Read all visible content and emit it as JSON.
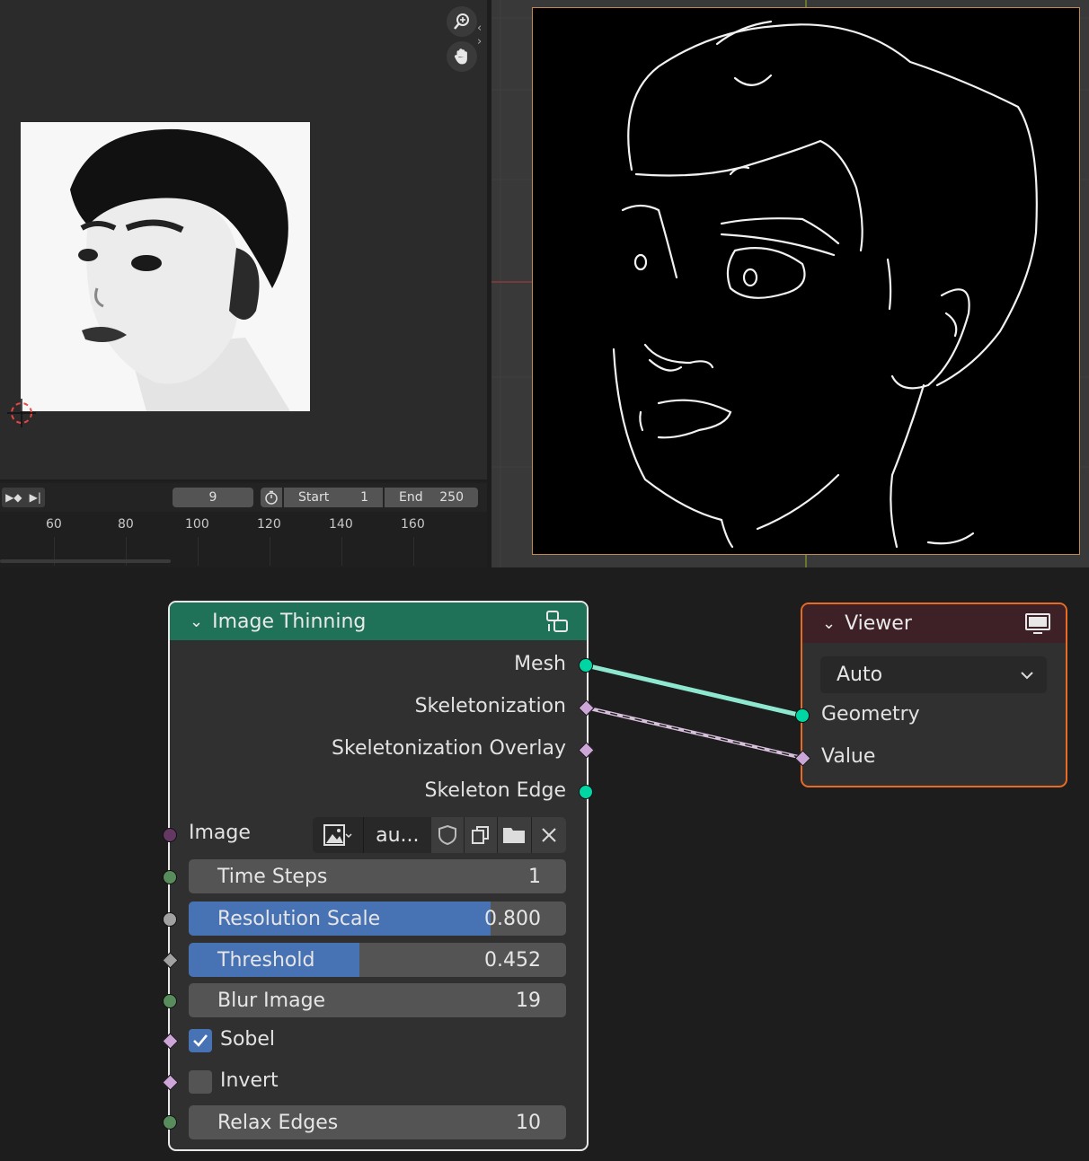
{
  "timeline": {
    "current_frame": "9",
    "start_label": "Start",
    "start_value": "1",
    "end_label": "End",
    "end_value": "250",
    "ticks": [
      "60",
      "80",
      "100",
      "120",
      "140",
      "160"
    ]
  },
  "image_thinning_node": {
    "title": "Image Thinning",
    "header_color": "#1f7158",
    "outputs": [
      "Mesh",
      "Skeletonization",
      "Skeletonization Overlay",
      "Skeleton Edge"
    ],
    "image_label": "Image",
    "image_name": "au...",
    "time_steps": {
      "label": "Time Steps",
      "value": "1"
    },
    "resolution_scale": {
      "label": "Resolution Scale",
      "value": "0.800",
      "fill_fraction": 0.8
    },
    "threshold": {
      "label": "Threshold",
      "value": "0.452",
      "fill_fraction": 0.452
    },
    "blur_image": {
      "label": "Blur Image",
      "value": "19"
    },
    "sobel": {
      "label": "Sobel",
      "checked": true
    },
    "invert": {
      "label": "Invert",
      "checked": false
    },
    "relax_edges": {
      "label": "Relax Edges",
      "value": "10"
    }
  },
  "viewer_node": {
    "title": "Viewer",
    "header_color": "#3e2027",
    "domain_selected": "Auto",
    "inputs": [
      "Geometry",
      "Value"
    ]
  },
  "colors": {
    "geometry_socket": "#00d6a3",
    "field_socket": "#cca6d6",
    "int_socket": "#598c5c",
    "float_socket": "#a1a1a1",
    "image_socket": "#633863",
    "accent_blue": "#4772b3",
    "viewer_outline": "#e86b24"
  }
}
